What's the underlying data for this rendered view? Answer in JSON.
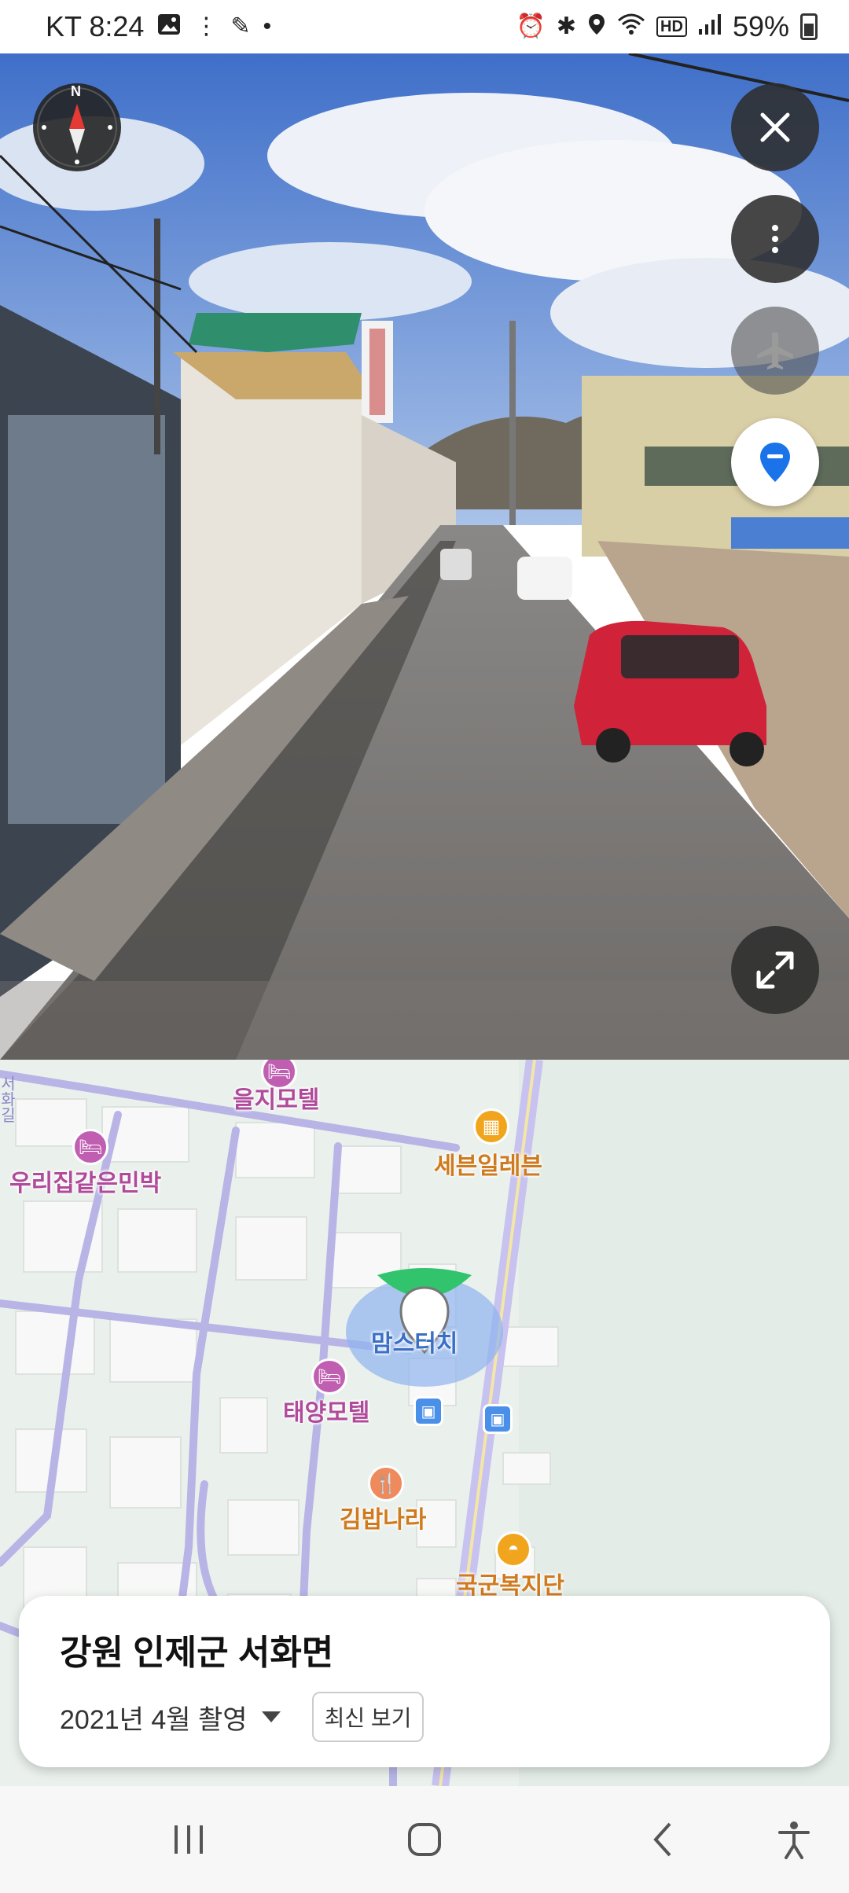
{
  "status_bar": {
    "carrier_time": "KT 8:24",
    "battery": "59%",
    "icons_left": [
      "gallery-icon",
      "more-dots-icon",
      "pen-icon",
      "dot-icon"
    ],
    "icons_right": [
      "alarm-icon",
      "bluetooth-icon",
      "location-icon",
      "wifi-icon",
      "hd-icon",
      "signal-icon",
      "battery-icon"
    ]
  },
  "street_view": {
    "compass_north": "N",
    "buttons": [
      "close-icon",
      "more-options-icon",
      "airplane-icon",
      "location-pin-icon",
      "expand-icon"
    ]
  },
  "map": {
    "pois": [
      {
        "name": "을지모텔",
        "type": "lodging"
      },
      {
        "name": "우리집같은민박",
        "type": "lodging"
      },
      {
        "name": "세븐일레븐",
        "type": "store"
      },
      {
        "name": "맘스터치",
        "type": "restaurant"
      },
      {
        "name": "태양모텔",
        "type": "lodging"
      },
      {
        "name": "김밥나라",
        "type": "restaurant"
      },
      {
        "name": "국군복지단",
        "type": "store"
      }
    ],
    "road_label": "서화길"
  },
  "info_card": {
    "title": "강원 인제군 서화면",
    "date": "2021년 4월 촬영",
    "latest_button": "최신 보기"
  },
  "colors": {
    "accent_blue": "#1a73e8",
    "road": "#b8b4e6",
    "map_bg": "#eaf0ec"
  }
}
